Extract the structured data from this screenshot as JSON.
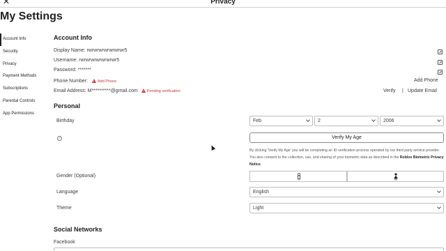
{
  "window": {
    "title": "Privacy",
    "close_icon": "close-icon"
  },
  "page_title": "My Settings",
  "sidebar": {
    "items": [
      {
        "label": "Account Info",
        "active": true
      },
      {
        "label": "Security"
      },
      {
        "label": "Privacy"
      },
      {
        "label": "Payment Methods"
      },
      {
        "label": "Subscriptions"
      },
      {
        "label": "Parental Controls"
      },
      {
        "label": "App Permissions"
      }
    ]
  },
  "account_info": {
    "heading": "Account Info",
    "display_name": "Display Name:  rwrwrwrwrwrwrwr5",
    "username": "Username: rwrwrwrwrwrwrwr5",
    "password": "Password: *******",
    "phone_label": "Phone Number:",
    "add_phone_inline": "Add Phone",
    "add_phone_right": "Add Phone",
    "email_label": "Email Address: M**********@gmail.com",
    "pending": "Pending verification",
    "verify": "Verify",
    "separator": "|",
    "update_email": "Update Email"
  },
  "personal": {
    "heading": "Personal",
    "birthday_label": "Birthday",
    "month": "Feb",
    "day": "2",
    "year": "2006",
    "verify_age_button": "Verify My Age",
    "notice_text": "By clicking 'Verify My Age' you will be completing an ID verification process operated by our third party service provider. You also consent to the collection, use, and sharing of your biometric data as described in the ",
    "notice_link": "Roblox Biometric Privacy Notice",
    "notice_end": ".",
    "gender_label": "Gender (Optional)",
    "language_label": "Language",
    "language_value": "English",
    "theme_label": "Theme",
    "theme_value": "Light"
  },
  "social": {
    "heading": "Social Networks",
    "facebook_label": "Facebook"
  },
  "colors": {
    "warning": "#c7353a",
    "text": "#393b3d",
    "border": "#bdbebe"
  }
}
